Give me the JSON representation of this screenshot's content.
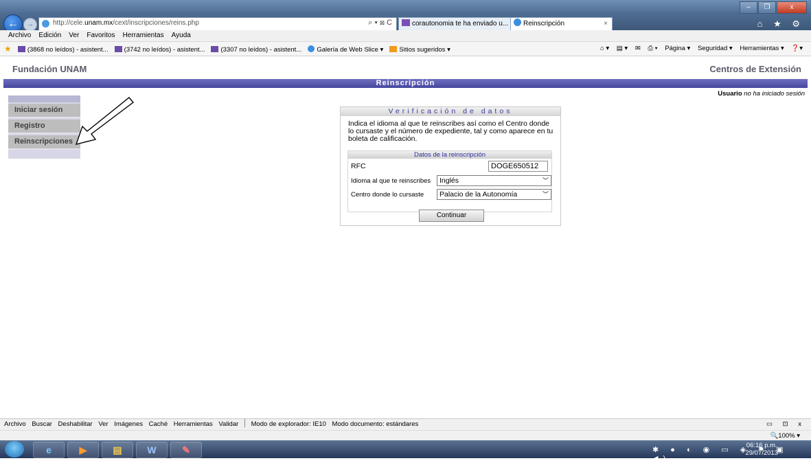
{
  "browser": {
    "url_prefix": "http://cele.",
    "url_domain": "unam.mx",
    "url_path": "/cext/inscripciones/reins.php",
    "address_tools": "⌕ ▾ ⊠ C",
    "tabs": [
      {
        "label": "corautonomia te ha enviado u..."
      },
      {
        "label": "Reinscripción"
      }
    ],
    "tab_close": "×",
    "window_buttons": [
      "–",
      "❐",
      "x"
    ],
    "chrome_icons": "⌂ ★ ⚙",
    "menu": [
      "Archivo",
      "Edición",
      "Ver",
      "Favoritos",
      "Herramientas",
      "Ayuda"
    ],
    "favorites": [
      {
        "label": "(3868 no leídos) - asistent...",
        "icon": "mail-icon"
      },
      {
        "label": "(3742 no leídos) - asistent...",
        "icon": "mail-icon"
      },
      {
        "label": "(3307 no leídos) - asistent...",
        "icon": "mail-icon"
      },
      {
        "label": "Galería de Web Slice ▾",
        "icon": "ie-icon"
      },
      {
        "label": "Sitios sugeridos ▾",
        "icon": "suggested-icon"
      }
    ],
    "commands": [
      "⌂ ▾",
      "▤ ▾",
      "✉",
      "⎙ ▾",
      "Página ▾",
      "Seguridad ▾",
      "Herramientas ▾",
      "❓▾"
    ]
  },
  "site": {
    "left_title": "Fundación UNAM",
    "right_title": "Centros de Extensión",
    "bar_title": "Reinscripción",
    "user_label": "Usuario",
    "user_status": "no ha iniciado sesión"
  },
  "sidebar": {
    "items": [
      {
        "label": "Iniciar sesión"
      },
      {
        "label": "Registro"
      },
      {
        "label": "Reinscripciones"
      }
    ]
  },
  "form": {
    "title": "Verificación de datos",
    "instructions": "Indica el idioma al que te reinscribes así como el Centro donde lo cursaste y el número de expediente, tal y como aparece en tu boleta de calificación.",
    "section_title": "Datos de la reinscripción",
    "rfc_label": "RFC",
    "rfc_value": "DOGE650512",
    "idioma_label": "Idioma al que te reinscribes",
    "idioma_value": "Inglés",
    "centro_label": "Centro donde lo cursaste",
    "centro_value": "Palacio de la Autonomía",
    "submit_label": "Continuar"
  },
  "devtools": {
    "items": [
      "Archivo",
      "Buscar",
      "Deshabilitar",
      "Ver",
      "Imágenes",
      "Caché",
      "Herramientas",
      "Validar"
    ],
    "mode": "Modo de explorador: IE10",
    "doc_mode": "Modo documento: estándares",
    "controls": "▭ ⊡ x"
  },
  "status": {
    "zoom": "🔍100% ▾"
  },
  "taskbar": {
    "time": "06:16 p.m.",
    "date": "29/07/2013",
    "tray": "✱ ● ◐ ◉ ▭ ◈ ⚑ ▣ ◀)"
  }
}
